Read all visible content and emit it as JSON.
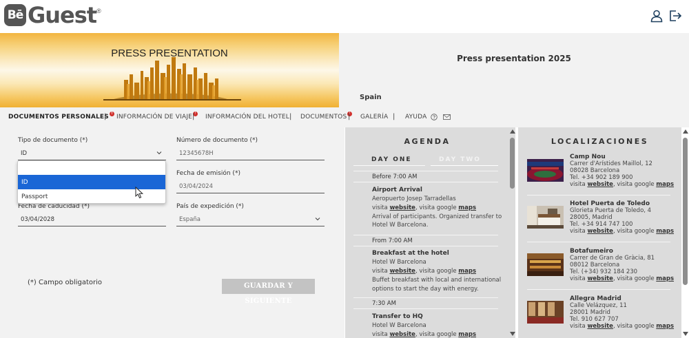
{
  "header": {
    "logo_mark": "Bē",
    "logo_text": "Guest",
    "logo_reg": "®",
    "user_icon": "user-icon",
    "logout_icon": "logout-icon"
  },
  "banner": {
    "title": "PRESS PRESENTATION",
    "event_name": "Press presentation 2025",
    "country": "Spain"
  },
  "nav": {
    "items": [
      {
        "label": "DOCUMENTOS PERSONALES",
        "badge": "!"
      },
      {
        "label": "INFORMACIÓN DE VIAJE",
        "badge": "!"
      },
      {
        "label": "INFORMACIÓN DEL HOTEL"
      },
      {
        "label": "DOCUMENTOS",
        "badge": "!"
      },
      {
        "label": "GALERÍA"
      },
      {
        "label": "AYUDA"
      }
    ],
    "separator": "|",
    "help_icon": "question-circle-icon",
    "mail_icon": "envelope-icon"
  },
  "form": {
    "doc_type_label": "Tipo de documento (*)",
    "doc_type_value": "ID",
    "doc_type_options": [
      "",
      "ID",
      "Passport"
    ],
    "doc_number_label": "Número de documento (*)",
    "doc_number_value": "12345678H",
    "issue_date_label": "Fecha de emisión (*)",
    "issue_date_value": "03/04/2024",
    "expiry_label": "Fecha de caducidad (*)",
    "expiry_value": "03/04/2028",
    "country_label": "País de expedición (*)",
    "country_value": "España",
    "required_note": "(*) Campo obligatorio",
    "save_button": "GUARDAR Y SIGUIENTE"
  },
  "agenda": {
    "title": "AGENDA",
    "tabs": [
      "DAY ONE",
      "DAY TWO"
    ],
    "items": [
      {
        "time": "Before 7:00 AM",
        "title": "Airport Arrival",
        "place": "Aeropuerto Josep Tarradellas",
        "links": {
          "prefix": "visita ",
          "website": "website",
          "mid": ", visita google ",
          "maps": "maps"
        },
        "desc": [
          "Arrival of participants. Organized transfer to",
          "Hotel W Barcelona."
        ]
      },
      {
        "time": "From 7:00 AM",
        "title": "Breakfast at the hotel",
        "place": "Hotel W Barcelona",
        "links": {
          "prefix": "visita ",
          "website": "website",
          "mid": ", visita google ",
          "maps": "maps"
        },
        "desc": [
          "Buffet breakfast with local and international",
          "options to start the day with energy."
        ]
      },
      {
        "time": "7:30 AM",
        "title": "Transfer to HQ",
        "place": "Hotel W Barcelona",
        "links": {
          "prefix": "visita ",
          "website": "website",
          "mid": ", visita google ",
          "maps": "maps"
        }
      }
    ]
  },
  "locations": {
    "title": "LOCALIZACIONES",
    "items": [
      {
        "name": "Camp Nou",
        "address": "Carrer d'Arístides Maillol, 12",
        "city": "08028 Barcelona",
        "phone": "Tel. +34 902 189 900",
        "links": {
          "prefix": "visita ",
          "website": "website",
          "mid": ", visita google ",
          "maps": "maps"
        }
      },
      {
        "name": "Hotel Puerta de Toledo",
        "address": "Glorieta Puerta de Toledo, 4",
        "city": "28005, Madrid",
        "phone": "Tel. +34 914 747 100",
        "links": {
          "prefix": "visita ",
          "website": "website",
          "mid": ", visita google ",
          "maps": "maps"
        }
      },
      {
        "name": "Botafumeiro",
        "address": "Carrer de Gran de Gràcia, 81",
        "city": "08012 Barcelona",
        "phone": "Tel. (+34) 932 184 230",
        "links": {
          "prefix": "visita ",
          "website": "website",
          "mid": ", visita google ",
          "maps": "maps"
        }
      },
      {
        "name": "Allegra Madrid",
        "address": "Calle Velázquez, 11",
        "city": "28001 Madrid",
        "phone": "Tel. 910 627 707",
        "links": {
          "prefix": "visita ",
          "website": "website",
          "mid": ", visita google ",
          "maps": "maps"
        }
      }
    ]
  },
  "colors": {
    "badge": "#d0312d",
    "selected_option": "#1a66d6",
    "disabled_button": "#c3c3c3",
    "panel_bg": "#dcdcdc",
    "page_bg": "#f2f2f2"
  }
}
